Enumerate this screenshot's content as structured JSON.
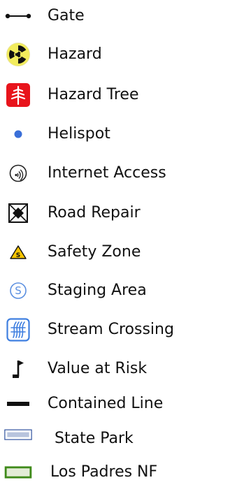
{
  "legend": {
    "items": [
      {
        "label": "Gate",
        "icon": "gate-icon"
      },
      {
        "label": "Hazard",
        "icon": "radiation-hazard-icon"
      },
      {
        "label": "Hazard Tree",
        "icon": "hazard-tree-icon"
      },
      {
        "label": "Helispot",
        "icon": "helispot-dot-icon"
      },
      {
        "label": "Internet Access",
        "icon": "wireless-signal-icon"
      },
      {
        "label": "Road Repair",
        "icon": "road-repair-icon"
      },
      {
        "label": "Safety Zone",
        "icon": "safety-zone-triangle-icon"
      },
      {
        "label": "Staging Area",
        "icon": "staging-area-s-icon"
      },
      {
        "label": "Stream Crossing",
        "icon": "stream-crossing-icon"
      },
      {
        "label": "Value at Risk",
        "icon": "flag-icon"
      },
      {
        "label": "Contained Line",
        "icon": "contained-line-icon"
      },
      {
        "label": "State Park",
        "icon": "state-park-swatch-icon"
      },
      {
        "label": "Los Padres NF",
        "icon": "national-forest-swatch-icon"
      }
    ],
    "colors": {
      "hazard_yellow": "#f2ec5c",
      "hazard_tree_red": "#e8141c",
      "helispot_blue": "#3a6fd8",
      "safety_zone_yellow": "#f5c400",
      "staging_blue": "#5b8fe0",
      "stream_blue": "#3f7fe0",
      "state_park_fill": "#b8c4dd",
      "state_park_border": "#3355a0",
      "forest_fill": "#e3ecd7",
      "forest_border": "#3f8a1a"
    }
  }
}
